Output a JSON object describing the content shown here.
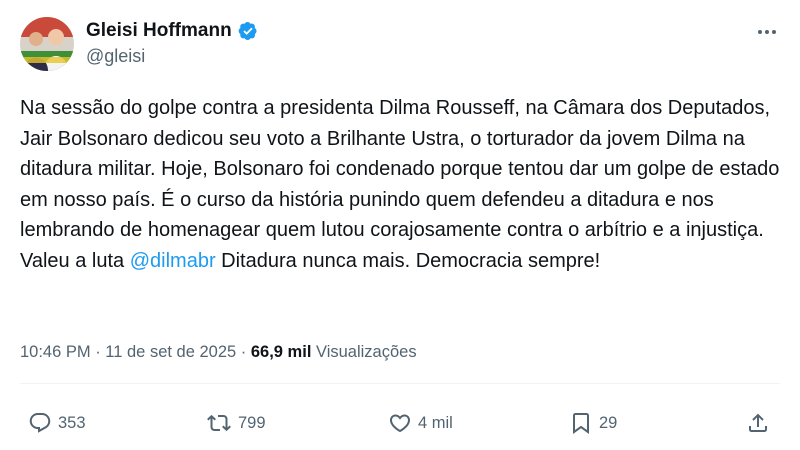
{
  "author": {
    "display_name": "Gleisi Hoffmann",
    "handle": "@gleisi",
    "verified": true,
    "verified_color": "#1d9bf0"
  },
  "tweet": {
    "text_before_mention": "Na sessão do golpe contra a presidenta Dilma Rousseff, na Câmara dos Deputados, Jair Bolsonaro dedicou seu voto a Brilhante Ustra, o torturador da jovem Dilma na ditadura militar. Hoje, Bolsonaro foi condenado porque tentou dar um golpe de estado em nosso país. É o curso da história punindo quem defendeu a ditadura e nos lembrando de homenagear quem lutou corajosamente contra o arbítrio e a injustiça. Valeu a luta ",
    "mention": "@dilmabr",
    "text_after_mention": " Ditadura nunca mais. Democracia sempre!",
    "mention_color": "#1d9bf0"
  },
  "meta": {
    "time": "10:46 PM",
    "separator1": " · ",
    "date": "11 de set de 2025",
    "separator2": " · ",
    "views_count": "66,9 mil",
    "views_label": " Visualizações"
  },
  "actions": {
    "reply": {
      "icon": "reply-icon",
      "count": "353"
    },
    "retweet": {
      "icon": "retweet-icon",
      "count": "799"
    },
    "like": {
      "icon": "heart-icon",
      "count": "4 mil"
    },
    "bookmark": {
      "icon": "bookmark-icon",
      "count": "29"
    },
    "share": {
      "icon": "share-icon"
    }
  },
  "colors": {
    "text_primary": "#0f1419",
    "text_secondary": "#536471",
    "accent": "#1d9bf0",
    "divider": "#eff3f4"
  }
}
